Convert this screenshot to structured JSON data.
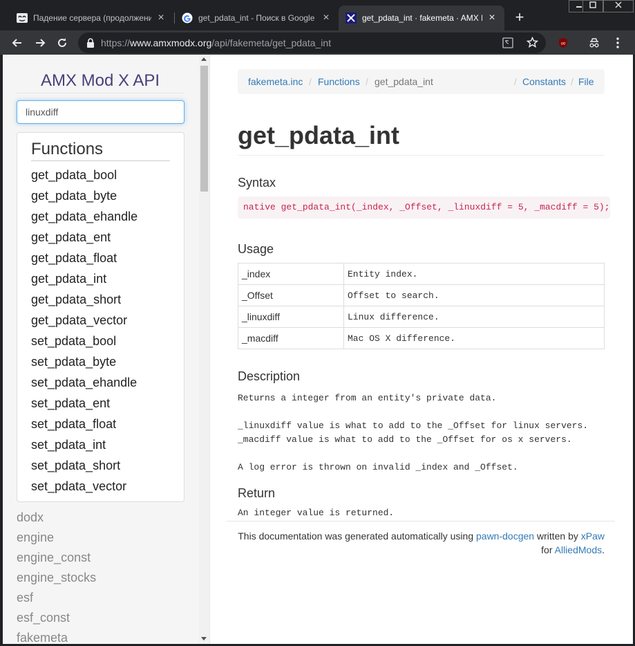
{
  "browser": {
    "tabs": [
      {
        "title": "Падение сервера (продолжение) |",
        "favicon": "mask-icon",
        "active": false
      },
      {
        "title": "get_pdata_int - Поиск в Google",
        "favicon": "google-icon",
        "active": false
      },
      {
        "title": "get_pdata_int · fakemeta · AMX Mod",
        "favicon": "amxx-icon",
        "active": true
      }
    ],
    "new_tab_label": "+",
    "url": {
      "scheme": "https://",
      "host": "www.amxmodx.org",
      "path": "/api/fakemeta/get_pdata_int"
    },
    "window_controls": [
      "minimize",
      "maximize",
      "close"
    ]
  },
  "sidebar": {
    "title": "AMX Mod X API",
    "search_value": "linuxdiff",
    "functions_heading": "Functions",
    "functions": [
      "get_pdata_bool",
      "get_pdata_byte",
      "get_pdata_ehandle",
      "get_pdata_ent",
      "get_pdata_float",
      "get_pdata_int",
      "get_pdata_short",
      "get_pdata_vector",
      "set_pdata_bool",
      "set_pdata_byte",
      "set_pdata_ehandle",
      "set_pdata_ent",
      "set_pdata_float",
      "set_pdata_int",
      "set_pdata_short",
      "set_pdata_vector"
    ],
    "includes": [
      "dodx",
      "engine",
      "engine_const",
      "engine_stocks",
      "esf",
      "esf_const",
      "fakemeta"
    ]
  },
  "breadcrumb": {
    "include": "fakemeta.inc",
    "section": "Functions",
    "current": "get_pdata_int",
    "sep": "/",
    "constants": "Constants",
    "file": "File"
  },
  "doc": {
    "title": "get_pdata_int",
    "syntax_heading": "Syntax",
    "syntax": "native get_pdata_int(_index, _Offset, _linuxdiff = 5, _macdiff = 5);",
    "usage_heading": "Usage",
    "params": [
      {
        "name": "_index",
        "desc": "Entity index."
      },
      {
        "name": "_Offset",
        "desc": "Offset to search."
      },
      {
        "name": "_linuxdiff",
        "desc": "Linux difference."
      },
      {
        "name": "_macdiff",
        "desc": "Mac OS X difference."
      }
    ],
    "description_heading": "Description",
    "description": "Returns a integer from an entity's private data.\n\n_linuxdiff value is what to add to the _Offset for linux servers.\n_macdiff value is what to add to the _Offset for os x servers.\n\nA log error is thrown on invalid _index and _Offset.",
    "return_heading": "Return",
    "return_text": "An integer value is returned."
  },
  "footer": {
    "text1": "This documentation was generated automatically using ",
    "link1": "pawn-docgen",
    "text2": " written by ",
    "link2": "xPaw",
    "text3": "for ",
    "link3": "AlliedMods",
    "text4": "."
  },
  "colors": {
    "title_purple": "#4a3f7a",
    "link_blue": "#337ab7",
    "code_red": "#c7254e",
    "chrome_dark": "#202124"
  }
}
